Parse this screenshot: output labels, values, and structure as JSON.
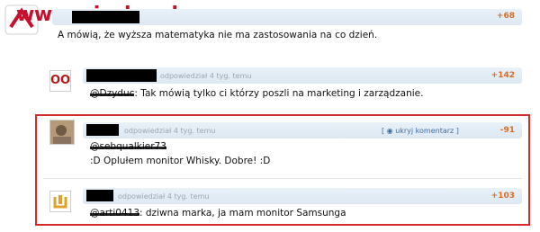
{
  "watermark": "www.wiocha.pl",
  "comments": [
    {
      "score": "+68",
      "text": "A mówią, że wyższa matematyka nie ma zastosowania na co dzień."
    },
    {
      "avatar_text": "OO",
      "meta": "odpowiedział 4 tyg. temu",
      "score": "+142",
      "mention": "@Dzyduc",
      "text": ": Tak mówią tylko ci którzy poszli na marketing i zarządzanie."
    },
    {
      "meta": "odpowiedział 4 tyg. temu",
      "hide_label": "[ ◉ ukryj komentarz ]",
      "score": "-91",
      "mention": "@sebqualkier73",
      "text": ":D Oplułem monitor Whisky. Dobre! :D"
    },
    {
      "meta": "odpowiedział 4 tyg. temu",
      "score": "+103",
      "mention": "@arti0413",
      "text": ": dziwna marka, ja mam monitor Samsunga"
    }
  ],
  "colors": {
    "highlight_border": "#d42a2a",
    "score": "#d76c2a",
    "watermark": "#c8102e"
  }
}
